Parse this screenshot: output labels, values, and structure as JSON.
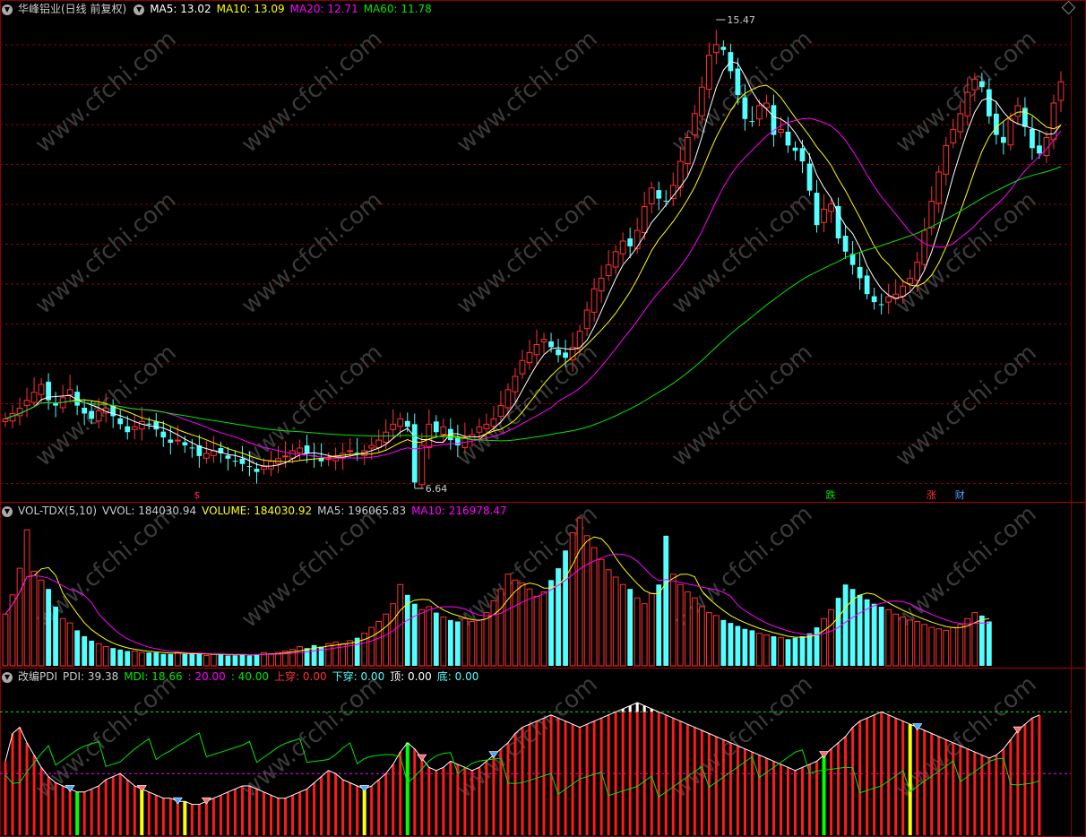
{
  "price_panel": {
    "stock_title": "华峰铝业(日线 前复权)",
    "ma5": "MA5: 13.02",
    "ma10": "MA10: 13.09",
    "ma20": "MA20: 12.71",
    "ma60": "MA60: 11.78",
    "high_label": "15.47",
    "low_label": "6.64",
    "markers": [
      "$",
      "跌",
      "涨",
      "财"
    ]
  },
  "volume_panel": {
    "title": "VOL-TDX(5,10)",
    "vvol": "VVOL: 184030.94",
    "volume": "VOLUME: 184030.92",
    "ma5": "MA5: 196065.83",
    "ma10": "MA10: 216978.47"
  },
  "pdi_panel": {
    "title": "改编PDI",
    "pdi": "PDI: 39.38",
    "mdi": "MDI: 18.66",
    "l20": ": 20.00",
    "l40": ": 40.00",
    "cross_up": "上穿: 0.00",
    "cross_down": "下穿: 0.00",
    "top": "顶: 0.00",
    "bottom": "底: 0.00"
  },
  "watermark": "www.cfchi.com",
  "colors": {
    "up": "#ff3232",
    "down": "#54ffff",
    "ma5": "#ffffff",
    "ma10": "#ffff00",
    "ma20": "#ff00ff",
    "ma60": "#00e600",
    "grid": "#8b0000"
  },
  "chart_data": [
    {
      "type": "candlestick",
      "title": "华峰铝业(日线 前复权)",
      "y_range": [
        6.64,
        15.47
      ],
      "extremes": {
        "high": 15.47,
        "low": 6.64
      },
      "ma_last": {
        "MA5": 13.02,
        "MA10": 13.09,
        "MA20": 12.71,
        "MA60": 11.78
      },
      "close": [
        7.95,
        8.05,
        8.15,
        8.3,
        8.45,
        8.6,
        8.3,
        8.2,
        8.35,
        8.5,
        8.2,
        8.05,
        7.95,
        8.1,
        8.15,
        8.0,
        7.85,
        7.7,
        7.8,
        7.9,
        7.85,
        7.75,
        7.6,
        7.5,
        7.55,
        7.45,
        7.4,
        7.25,
        7.3,
        7.35,
        7.3,
        7.2,
        7.15,
        7.1,
        7.05,
        6.95,
        7.05,
        7.15,
        7.2,
        7.25,
        7.35,
        7.4,
        7.3,
        7.25,
        7.15,
        7.2,
        7.25,
        7.3,
        7.35,
        7.3,
        7.35,
        7.45,
        7.55,
        7.7,
        7.85,
        7.95,
        7.8,
        6.75,
        7.45,
        7.85,
        7.7,
        7.8,
        7.55,
        7.45,
        7.6,
        7.65,
        7.8,
        7.85,
        7.95,
        8.2,
        8.5,
        8.75,
        9.05,
        9.2,
        9.35,
        9.45,
        9.3,
        9.15,
        9.1,
        9.3,
        9.6,
        10.0,
        10.4,
        10.6,
        10.85,
        11.1,
        11.3,
        11.2,
        11.5,
        11.95,
        12.3,
        12.1,
        12.05,
        12.35,
        12.8,
        13.25,
        13.7,
        14.2,
        14.8,
        15.0,
        14.9,
        14.5,
        14.05,
        13.6,
        13.55,
        13.85,
        13.9,
        13.3,
        13.4,
        13.1,
        13.0,
        12.8,
        12.25,
        11.6,
        11.9,
        12.0,
        11.35,
        11.1,
        10.85,
        10.6,
        10.3,
        10.15,
        10.1,
        10.25,
        10.3,
        10.45,
        10.6,
        10.9,
        11.5,
        12.05,
        12.6,
        13.1,
        13.4,
        13.7,
        14.1,
        14.35,
        14.2,
        13.65,
        13.3,
        13.15,
        13.6,
        13.85,
        13.45,
        13.05,
        12.95,
        13.25,
        13.9,
        14.3
      ]
    },
    {
      "type": "bar",
      "title": "VOL-TDX(5,10)",
      "series": [
        {
          "name": "VOLUME",
          "last": 184030.92
        },
        {
          "name": "MA5",
          "last": 196065.83
        },
        {
          "name": "MA10",
          "last": 216978.47
        }
      ],
      "vvol_last": 184030.94,
      "volume_rel": [
        0.35,
        0.48,
        0.66,
        0.92,
        0.64,
        0.58,
        0.52,
        0.4,
        0.32,
        0.29,
        0.24,
        0.2,
        0.17,
        0.15,
        0.13,
        0.12,
        0.11,
        0.1,
        0.1,
        0.09,
        0.09,
        0.09,
        0.08,
        0.08,
        0.09,
        0.08,
        0.08,
        0.08,
        0.07,
        0.08,
        0.08,
        0.07,
        0.07,
        0.08,
        0.07,
        0.08,
        0.09,
        0.08,
        0.09,
        0.1,
        0.11,
        0.13,
        0.12,
        0.14,
        0.13,
        0.15,
        0.16,
        0.15,
        0.17,
        0.19,
        0.22,
        0.26,
        0.3,
        0.35,
        0.42,
        0.55,
        0.48,
        0.42,
        0.38,
        0.4,
        0.36,
        0.33,
        0.31,
        0.3,
        0.32,
        0.3,
        0.31,
        0.36,
        0.44,
        0.52,
        0.62,
        0.58,
        0.56,
        0.52,
        0.47,
        0.5,
        0.58,
        0.66,
        0.78,
        0.9,
        1.0,
        0.88,
        0.8,
        0.72,
        0.65,
        0.6,
        0.55,
        0.52,
        0.46,
        0.42,
        0.49,
        0.55,
        0.88,
        0.62,
        0.55,
        0.5,
        0.46,
        0.4,
        0.36,
        0.34,
        0.31,
        0.29,
        0.27,
        0.25,
        0.24,
        0.22,
        0.21,
        0.2,
        0.19,
        0.18,
        0.19,
        0.2,
        0.22,
        0.26,
        0.32,
        0.38,
        0.46,
        0.55,
        0.52,
        0.48,
        0.45,
        0.42,
        0.4,
        0.38,
        0.35,
        0.33,
        0.31,
        0.3,
        0.28,
        0.26,
        0.25,
        0.24,
        0.26,
        0.28,
        0.32,
        0.36,
        0.34,
        0.3
      ]
    },
    {
      "type": "bar",
      "title": "改编PDI",
      "series": [
        {
          "name": "PDI",
          "last": 39.38
        },
        {
          "name": "MDI",
          "last": 18.66
        }
      ],
      "reference_lines": [
        20,
        40
      ],
      "signals": {
        "上穿": 0.0,
        "下穿": 0.0,
        "顶": 0.0,
        "底": 0.0
      },
      "pdi": [
        24,
        33,
        35,
        30,
        26,
        22,
        19,
        17,
        16,
        15,
        14,
        14,
        15,
        16,
        18,
        19,
        20,
        18,
        16,
        15,
        14,
        13,
        12,
        12,
        11,
        11,
        10,
        10,
        11,
        12,
        13,
        14,
        15,
        16,
        16,
        15,
        14,
        13,
        12,
        12,
        13,
        14,
        15,
        17,
        19,
        21,
        20,
        18,
        17,
        16,
        15,
        16,
        18,
        20,
        23,
        27,
        30,
        28,
        25,
        22,
        21,
        22,
        24,
        23,
        22,
        21,
        22,
        24,
        26,
        28,
        30,
        33,
        35,
        36,
        37,
        38,
        39,
        38,
        37,
        36,
        35,
        36,
        37,
        38,
        39,
        40,
        41,
        42,
        43,
        42,
        41,
        40,
        39,
        38,
        37,
        36,
        35,
        34,
        33,
        32,
        31,
        30,
        29,
        28,
        27,
        26,
        25,
        24,
        23,
        22,
        21,
        22,
        23,
        24,
        26,
        28,
        30,
        32,
        35,
        37,
        38,
        39,
        40,
        39,
        38,
        37,
        36,
        35,
        34,
        33,
        32,
        31,
        30,
        29,
        28,
        27,
        26,
        25,
        26,
        28,
        31,
        34,
        36,
        38,
        39
      ]
    }
  ]
}
